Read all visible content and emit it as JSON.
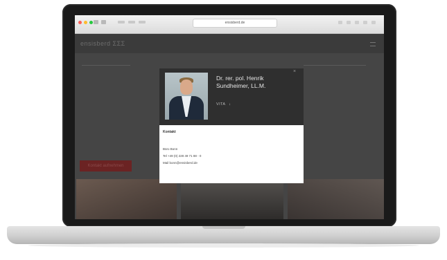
{
  "browser": {
    "url": "ensisberd.de"
  },
  "site": {
    "logo_text": "ensisberd ΣΣΣ",
    "cta_label": "Kontakt aufnehmen"
  },
  "modal": {
    "name": "Dr. rer. pol. Henrik Sundheimer, LL.M.",
    "vita_label": "VITA",
    "vita_arrow": "↓",
    "close_glyph": "×",
    "contact": {
      "heading": "Kontakt",
      "office": "Büro Bonn",
      "phone": "Tel +49 (0) 228 49 71 88 - 0",
      "email": "Mail bonn@ensisberd.de"
    }
  },
  "colors": {
    "overlay_dark": "#2f2f2f",
    "cta_red": "#6b2323"
  }
}
